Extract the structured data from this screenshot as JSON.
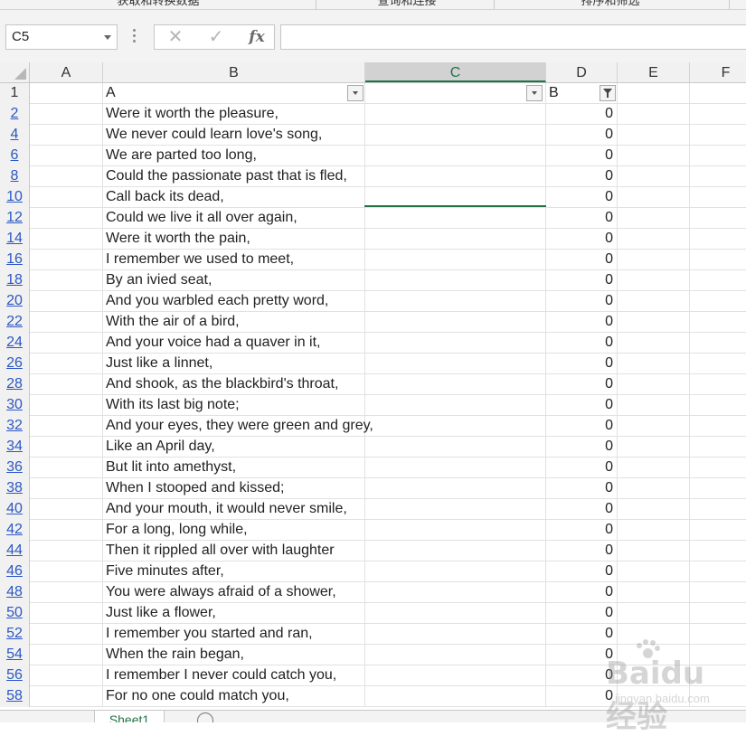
{
  "ribbon": {
    "groups": [
      "获取和转换数据",
      "查询和连接",
      "排序和筛选"
    ]
  },
  "formula_bar": {
    "name_box": "C5",
    "cancel_icon": "✕",
    "enter_icon": "✓",
    "fx_label": "fx",
    "formula": ""
  },
  "columns": [
    "A",
    "B",
    "C",
    "D",
    "E",
    "F"
  ],
  "selected_column": "C",
  "header_row": {
    "row_label": "1",
    "B": "A",
    "D": "B"
  },
  "rows": [
    {
      "n": "2",
      "b": "Were it worth the pleasure,",
      "d": "0"
    },
    {
      "n": "4",
      "b": "We never could learn love's song,",
      "d": "0"
    },
    {
      "n": "6",
      "b": "We are parted too long,",
      "d": "0"
    },
    {
      "n": "8",
      "b": "Could the passionate past that is fled,",
      "d": "0"
    },
    {
      "n": "10",
      "b": "Call back its dead,",
      "d": "0"
    },
    {
      "n": "12",
      "b": "Could we live it all over again,",
      "d": "0"
    },
    {
      "n": "14",
      "b": "Were it worth the pain,",
      "d": "0"
    },
    {
      "n": "16",
      "b": "I remember we used to meet,",
      "d": "0"
    },
    {
      "n": "18",
      "b": "By an ivied seat,",
      "d": "0"
    },
    {
      "n": "20",
      "b": "And you warbled each pretty word,",
      "d": "0"
    },
    {
      "n": "22",
      "b": "With the air of a bird,",
      "d": "0"
    },
    {
      "n": "24",
      "b": "And your voice had a quaver in it,",
      "d": "0"
    },
    {
      "n": "26",
      "b": "Just like a linnet,",
      "d": "0"
    },
    {
      "n": "28",
      "b": "And shook, as the blackbird's throat,",
      "d": "0"
    },
    {
      "n": "30",
      "b": "With its last big note;",
      "d": "0"
    },
    {
      "n": "32",
      "b": "And your eyes, they were green and grey,",
      "d": "0"
    },
    {
      "n": "34",
      "b": "Like an April day,",
      "d": "0"
    },
    {
      "n": "36",
      "b": "But lit into amethyst,",
      "d": "0"
    },
    {
      "n": "38",
      "b": "When I stooped and kissed;",
      "d": "0"
    },
    {
      "n": "40",
      "b": "And your mouth, it would never smile,",
      "d": "0"
    },
    {
      "n": "42",
      "b": "For a long, long while,",
      "d": "0"
    },
    {
      "n": "44",
      "b": "Then it rippled all over with laughter",
      "d": "0"
    },
    {
      "n": "46",
      "b": "Five minutes after,",
      "d": "0"
    },
    {
      "n": "48",
      "b": "You were always afraid of a shower,",
      "d": "0"
    },
    {
      "n": "50",
      "b": "Just like a flower,",
      "d": "0"
    },
    {
      "n": "52",
      "b": "I remember you started and ran,",
      "d": "0"
    },
    {
      "n": "54",
      "b": "When the rain began,",
      "d": "0"
    },
    {
      "n": "56",
      "b": "I remember I never could catch you,",
      "d": "0"
    },
    {
      "n": "58",
      "b": "For no one could match you,",
      "d": "0"
    }
  ],
  "sheet_tabs": [
    "Sheet1"
  ],
  "watermark": {
    "text": "Baidu经验",
    "sub": "jingyan.baidu.com"
  },
  "colors": {
    "accent": "#217346",
    "row_link": "#2b57c4"
  }
}
